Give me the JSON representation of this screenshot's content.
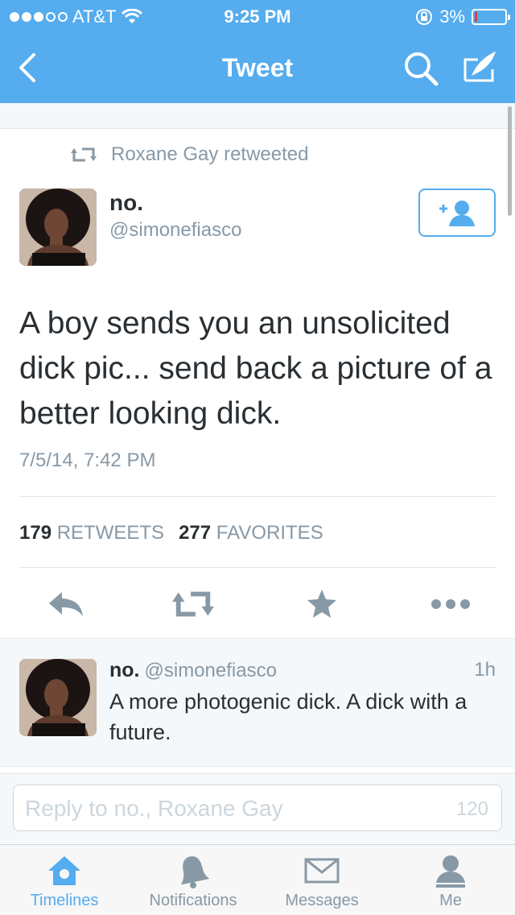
{
  "status_bar": {
    "carrier": "AT&T",
    "time": "9:25 PM",
    "battery": "3%",
    "signal_bars_filled": 3,
    "signal_bars_total": 5
  },
  "nav": {
    "title": "Tweet",
    "back_icon": "chevron-left-icon",
    "search_icon": "search-icon",
    "compose_icon": "compose-quill-icon"
  },
  "tweet": {
    "retweeted_by": "Roxane Gay retweeted",
    "author_name": "no.",
    "author_handle": "@simonefiasco",
    "text": "A boy sends you an unsolicited dick pic... send back a picture of a better looking dick.",
    "timestamp": "7/5/14, 7:42 PM",
    "retweets_count": "179",
    "retweets_label": "RETWEETS",
    "favorites_count": "277",
    "favorites_label": "FAVORITES"
  },
  "reply_tweet": {
    "author_name": "no.",
    "author_handle": "@simonefiasco",
    "time": "1h",
    "text": "A more photogenic dick. A dick with a future."
  },
  "compose": {
    "placeholder": "Reply to no., Roxane Gay",
    "char_count": "120"
  },
  "tabs": [
    {
      "label": "Timelines",
      "icon": "home-icon",
      "active": true
    },
    {
      "label": "Notifications",
      "icon": "bell-icon",
      "active": false
    },
    {
      "label": "Messages",
      "icon": "envelope-icon",
      "active": false
    },
    {
      "label": "Me",
      "icon": "person-icon",
      "active": false
    }
  ],
  "colors": {
    "brand": "#55acee",
    "text": "#292f33",
    "muted": "#8899a6",
    "battery_low": "#e0403a"
  }
}
